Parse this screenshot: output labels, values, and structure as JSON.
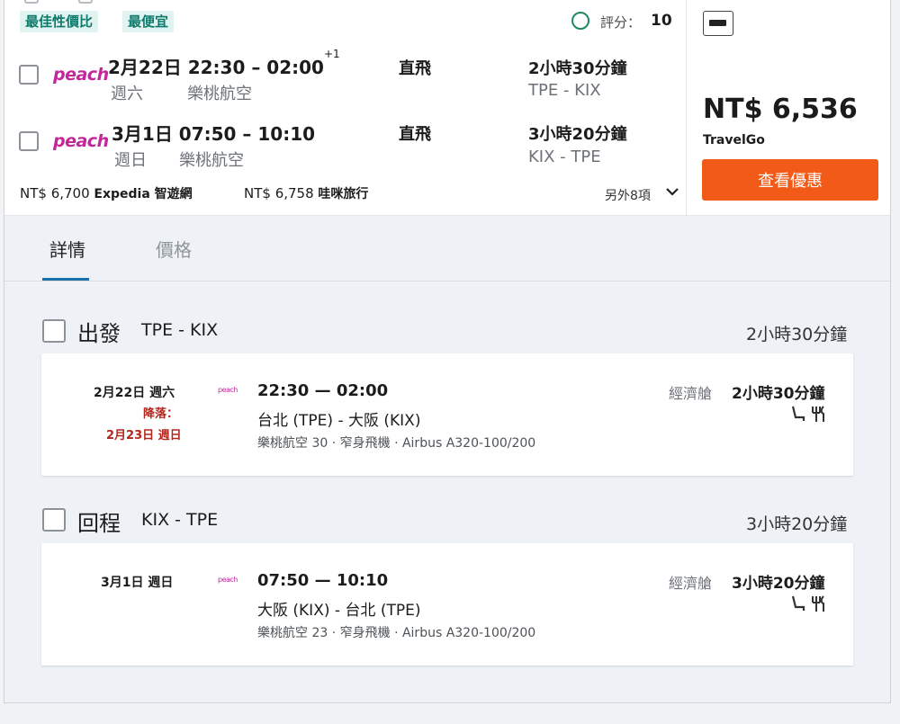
{
  "tags": {
    "best": "最佳性價比",
    "cheapest": "最便宜"
  },
  "score": {
    "label": "評分：",
    "value": "10"
  },
  "outbound": {
    "airline_logo": "peach",
    "time": "2月22日 22:30 – 02:00",
    "day_offset": "+1",
    "weekday": "週六",
    "airline": "樂桃航空",
    "stops": "直飛",
    "duration": "2小時30分鐘",
    "route": "TPE - KIX"
  },
  "return": {
    "airline_logo": "peach",
    "time": "3月1日 07:50 – 10:10",
    "weekday": "週日",
    "airline": "樂桃航空",
    "stops": "直飛",
    "duration": "3小時20分鐘",
    "route": "KIX - TPE"
  },
  "alt_prices": [
    {
      "price": "NT$ 6,700",
      "provider": "Expedia 智遊網"
    },
    {
      "price": "NT$ 6,758",
      "provider": "哇咪旅行"
    }
  ],
  "more_options": "另外8項",
  "deal": {
    "price": "NT$ 6,536",
    "provider": "TravelGo",
    "cta": "查看優惠"
  },
  "tabs": [
    "詳情",
    "價格"
  ],
  "legs": [
    {
      "label": "出發",
      "route": "TPE - KIX",
      "duration": "2小時30分鐘",
      "segment": {
        "date": "2月22日 週六",
        "arrival_label": "降落：",
        "arrival_date": "2月23日 週日",
        "logo": "peach",
        "time": "22:30 — 02:00",
        "route": "台北 (TPE) - 大阪 (KIX)",
        "info": "樂桃航空 30 · 窄身飛機 · Airbus A320-100/200",
        "cabin": "經濟艙",
        "duration": "2小時30分鐘"
      }
    },
    {
      "label": "回程",
      "route": "KIX - TPE",
      "duration": "3小時20分鐘",
      "segment": {
        "date": "3月1日 週日",
        "logo": "peach",
        "time": "07:50 — 10:10",
        "route": "大阪 (KIX) - 台北 (TPE)",
        "info": "樂桃航空 23 · 窄身飛機 · Airbus A320-100/200",
        "cabin": "經濟艙",
        "duration": "3小時20分鐘"
      }
    }
  ],
  "icons": {
    "seat": "seat-icon",
    "meal": "meal-icon",
    "payment": "credit-card-icon",
    "chevron": "chevron-down-icon",
    "score": "score-ring-icon"
  },
  "colors": {
    "accent": "#f25a17",
    "tag_text": "#0d7a6c",
    "tag_bg": "#e1f3f0",
    "peach": "#c3289a",
    "arrival": "#b3261e",
    "tab_underline": "#1b6fa8"
  }
}
